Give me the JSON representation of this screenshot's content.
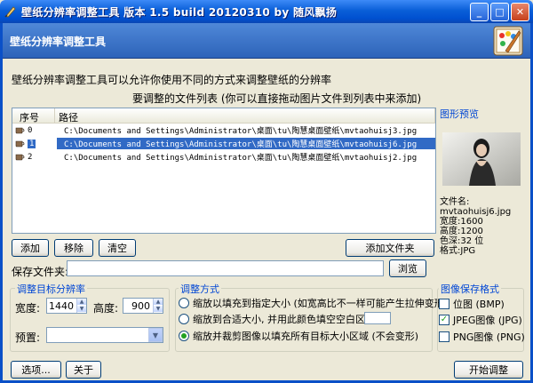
{
  "window": {
    "title": "壁纸分辨率调整工具  版本 1.5 build 20120310 by 随风飘扬",
    "controls": [
      "minimize-icon",
      "maximize-icon",
      "close-icon"
    ]
  },
  "banner": {
    "title": "壁纸分辨率调整工具"
  },
  "main": {
    "description": "壁纸分辨率调整工具可以允许你使用不同的方式来调整壁纸的分辨率",
    "list_caption": "要调整的文件列表 (你可以直接拖动图片文件到列表中来添加)",
    "columns": [
      "序号",
      "路径"
    ],
    "rows": [
      {
        "index": "0",
        "path": "C:\\Documents and Settings\\Administrator\\桌面\\tu\\陶慧桌面壁纸\\mvtaohuisj3.jpg",
        "selected": false
      },
      {
        "index": "1",
        "path": "C:\\Documents and Settings\\Administrator\\桌面\\tu\\陶慧桌面壁纸\\mvtaohuisj6.jpg",
        "selected": true
      },
      {
        "index": "2",
        "path": "C:\\Documents and Settings\\Administrator\\桌面\\tu\\陶慧桌面壁纸\\mvtaohuisj2.jpg",
        "selected": false
      }
    ],
    "buttons": {
      "add": "添加",
      "remove": "移除",
      "clear": "清空",
      "add_folder": "添加文件夹",
      "browse": "浏览"
    },
    "save_folder_label": "保存文件夹:",
    "save_folder_value": ""
  },
  "preview": {
    "label": "图形预览",
    "filename_label": "文件名:",
    "filename": "mvtaohuisj6.jpg",
    "width": "宽度:1600",
    "height": "高度:1200",
    "depth": "色深:32 位",
    "format": "格式:JPG"
  },
  "resolution": {
    "title": "调整目标分辨率",
    "width_label": "宽度:",
    "width_value": "1440",
    "height_label": "高度:",
    "height_value": "900",
    "preset_label": "预置:",
    "preset_value": ""
  },
  "mode": {
    "title": "调整方式",
    "options": [
      {
        "label": "缩放以填充到指定大小 (如宽高比不一样可能产生拉伸变形)",
        "checked": false
      },
      {
        "label": "缩放到合适大小, 并用此颜色填空空白区域",
        "checked": false
      },
      {
        "label": "缩放并裁剪图像以填充所有目标大小区域 (不会变形)",
        "checked": true
      }
    ]
  },
  "format": {
    "title": "图像保存格式",
    "options": [
      {
        "label": "位图 (BMP)",
        "checked": false
      },
      {
        "label": "JPEG图像 (JPG)",
        "checked": true
      },
      {
        "label": "PNG图像 (PNG)",
        "checked": false
      }
    ]
  },
  "footer": {
    "options": "选项...",
    "about": "关于",
    "start": "开始调整"
  }
}
